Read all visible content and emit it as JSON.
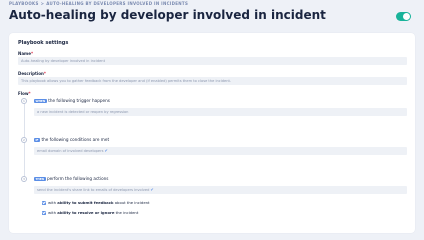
{
  "breadcrumb": {
    "items": [
      "PLAYBOOKS",
      "AUTO-HEALING BY DEVELOPERS INVOLVED IN INCIDENTS"
    ],
    "separator": ">"
  },
  "page": {
    "title": "Auto-healing by developer involved in incident",
    "enabled": true
  },
  "settings": {
    "heading": "Playbook settings",
    "name_label": "Name",
    "name_value": "Auto-healing by developer involved in incident",
    "description_label": "Description",
    "description_value": "This playbook allows you to gather feedback from the developer and (if enabled) permits them to close the incident.",
    "required_mark": "*",
    "flow_label": "Flow"
  },
  "flow": {
    "step1": {
      "number": "1",
      "tag": "WHEN",
      "text": "the following trigger happens",
      "value": "a new incident is detected or reopen by regression"
    },
    "step2": {
      "number": "2",
      "tag": "IF",
      "text": "the following conditions are met",
      "value": "email domain of involved developers"
    },
    "step3": {
      "number": "3",
      "tag": "THEN",
      "text": "perform the following actions",
      "value": "send the incident's share link to emails of developers involved"
    },
    "option1": {
      "prefix": "with",
      "bold": "ability to submit feedback",
      "suffix": "about the incident"
    },
    "option2": {
      "prefix": "with",
      "bold": "ability to resolve or ignore",
      "suffix": "the incident"
    }
  },
  "colors": {
    "toggle_on": "#19b39a",
    "accent": "#5b8ee6",
    "required": "#e0425a"
  }
}
